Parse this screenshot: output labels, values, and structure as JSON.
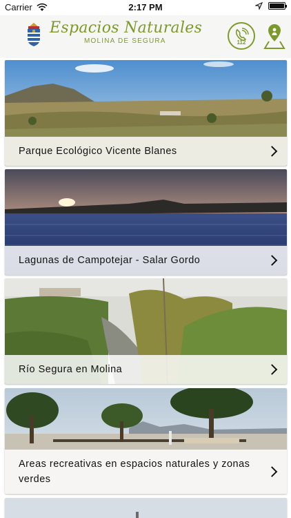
{
  "status_bar": {
    "carrier": "Carrier",
    "time": "2:17 PM",
    "battery_level": 1.0
  },
  "header": {
    "title": "Espacios Naturales",
    "subtitle": "MOLINA DE SEGURA",
    "emergency_number": "112",
    "icons": {
      "logo": "coat-of-arms-icon",
      "call": "phone-112-icon",
      "location": "map-pin-icon"
    },
    "colors": {
      "brand": "#7c9a2c",
      "header_bg": "#f6f6f4"
    }
  },
  "places": [
    {
      "label": "Parque Ecológico Vicente Blanes"
    },
    {
      "label": "Lagunas de Campotejar - Salar Gordo"
    },
    {
      "label": "Río Segura en Molina"
    },
    {
      "label": "Areas recreativas en espacios naturales y zonas verdes"
    }
  ]
}
